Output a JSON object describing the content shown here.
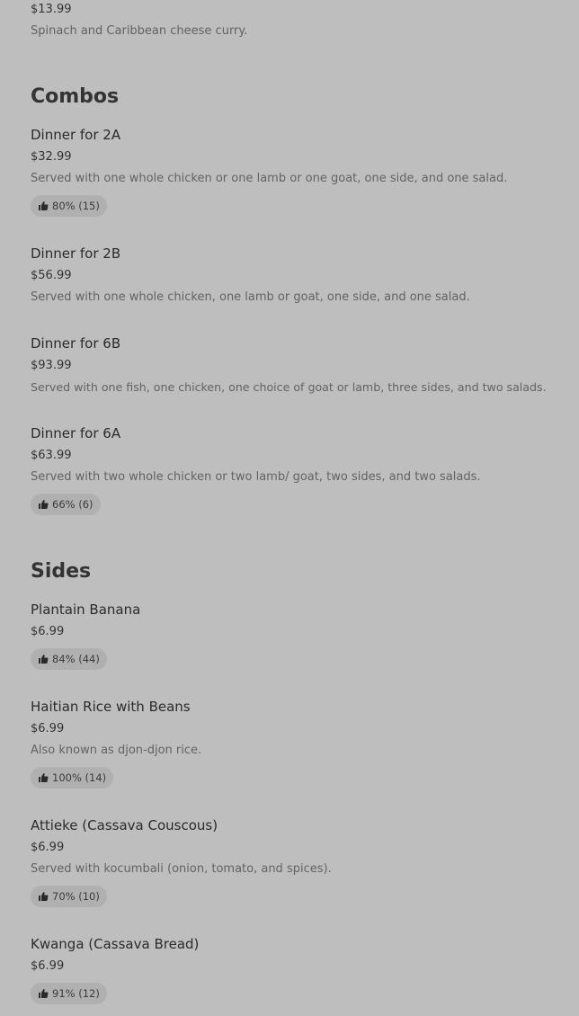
{
  "top_item": {
    "price": "$13.99",
    "description": "Spinach and Caribbean cheese curry."
  },
  "sections": [
    {
      "title": "Combos",
      "items": [
        {
          "name": "Dinner for 2A",
          "price": "$32.99",
          "description": "Served with one whole chicken or one lamb or one goat, one side, and one salad.",
          "rating": "80% (15)"
        },
        {
          "name": "Dinner for 2B",
          "price": "$56.99",
          "description": "Served with one whole chicken, one lamb or goat, one side, and one salad."
        },
        {
          "name": "Dinner for 6B",
          "price": "$93.99",
          "description": "Served with one fish, one chicken, one choice of goat or lamb, three sides, and two salads."
        },
        {
          "name": "Dinner for 6A",
          "price": "$63.99",
          "description": "Served with two whole chicken or two lamb/ goat, two sides, and two salads.",
          "rating": "66% (6)"
        }
      ]
    },
    {
      "title": "Sides",
      "items": [
        {
          "name": "Plantain Banana",
          "price": "$6.99",
          "rating": "84% (44)"
        },
        {
          "name": "Haitian Rice with Beans",
          "price": "$6.99",
          "description": "Also known as djon-djon rice.",
          "rating": "100% (14)"
        },
        {
          "name": "Attieke (Cassava Couscous)",
          "price": "$6.99",
          "description": "Served with kocumbali (onion, tomato, and spices).",
          "rating": "70% (10)"
        },
        {
          "name": "Kwanga (Cassava Bread)",
          "price": "$6.99",
          "rating": "91% (12)"
        }
      ]
    }
  ],
  "icons": {
    "rating": "thumbs-up-icon"
  },
  "colors": {
    "background": "#bebebe",
    "badge": "#b0b0b0",
    "text": "#2f2f2f",
    "muted_text": "#636363"
  }
}
